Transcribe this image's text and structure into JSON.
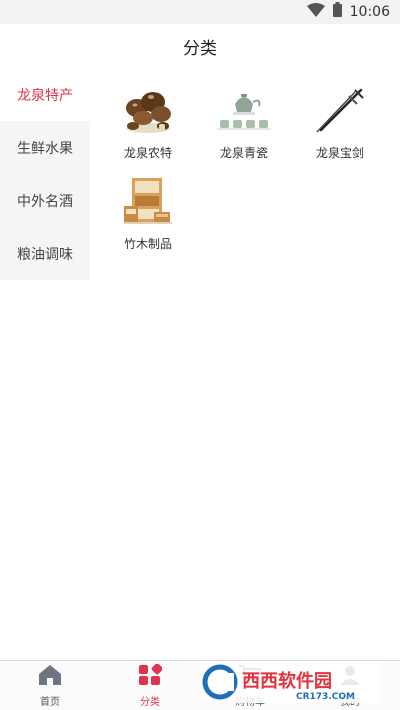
{
  "status": {
    "time": "10:06"
  },
  "header": {
    "title": "分类"
  },
  "sidebar": {
    "items": [
      {
        "label": "龙泉特产",
        "active": true
      },
      {
        "label": "生鲜水果",
        "active": false
      },
      {
        "label": "中外名酒",
        "active": false
      },
      {
        "label": "粮油调味",
        "active": false
      }
    ]
  },
  "categories": [
    {
      "label": "龙泉农特",
      "icon": "mushroom-icon"
    },
    {
      "label": "龙泉青瓷",
      "icon": "celadon-teaset-icon"
    },
    {
      "label": "龙泉宝剑",
      "icon": "sword-icon"
    },
    {
      "label": "竹木制品",
      "icon": "bamboo-cabinet-icon"
    }
  ],
  "tabbar": {
    "items": [
      {
        "label": "首页",
        "icon": "home-icon"
      },
      {
        "label": "分类",
        "icon": "category-icon",
        "active": true
      },
      {
        "label": "购物车",
        "icon": "cart-icon"
      },
      {
        "label": "我的",
        "icon": "profile-icon"
      }
    ]
  },
  "watermark": {
    "brand": "西西软件园",
    "site": "CR173.COM"
  },
  "colors": {
    "accent": "#e0334d",
    "sidebar_bg": "#f5f5f5",
    "status_bg": "#f2f2f2"
  }
}
